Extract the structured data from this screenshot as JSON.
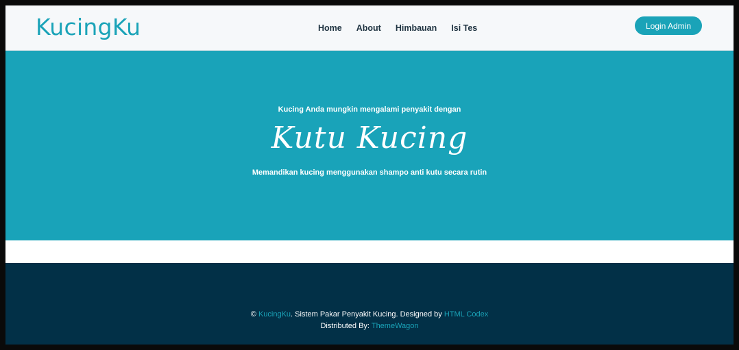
{
  "brand": {
    "name": "KucingKu"
  },
  "nav": {
    "items": [
      {
        "label": "Home"
      },
      {
        "label": "About"
      },
      {
        "label": "Himbauan"
      },
      {
        "label": "Isi Tes"
      }
    ],
    "login_label": "Login Admin"
  },
  "hero": {
    "lead": "Kucing Anda mungkin mengalami penyakit dengan",
    "title": "Kutu Kucing",
    "subtitle": "Memandikan kucing menggunakan shampo anti kutu secara rutin"
  },
  "footer": {
    "copyright_symbol": "©",
    "brand_link": "KucingKu",
    "text1": ". Sistem Pakar Penyakit Kucing. Designed by ",
    "designer_link": "HTML Codex",
    "distributed_label": "Distributed By: ",
    "distributor_link": "ThemeWagon"
  },
  "colors": {
    "accent": "#1aa3b8",
    "hero_bg": "#19a3b9",
    "footer_bg": "#023047",
    "navbar_bg": "#f6f8fa",
    "nav_text": "#1f3341"
  }
}
